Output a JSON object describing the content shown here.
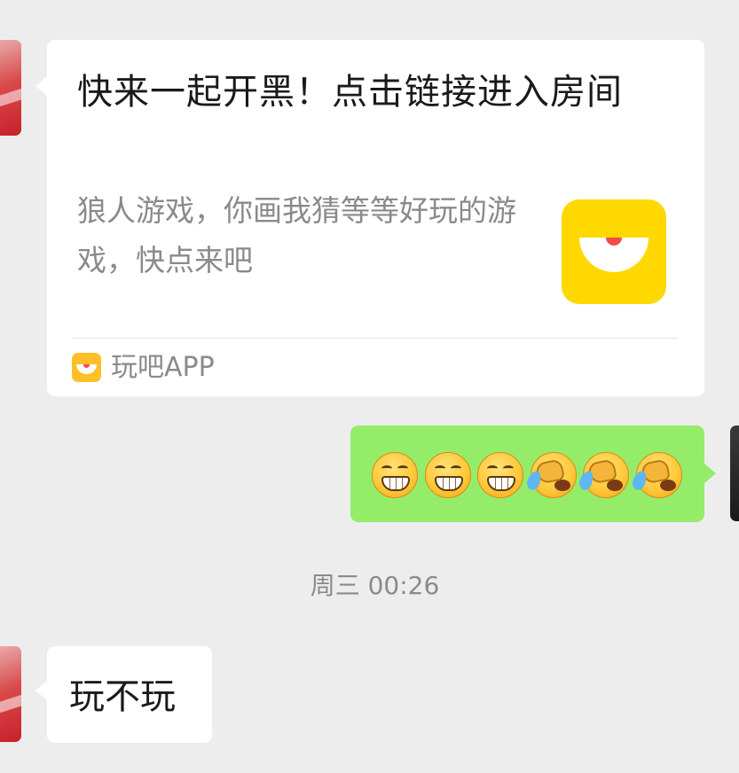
{
  "shared_card": {
    "title": "快来一起开黑！点击链接进入房间",
    "description": "狼人游戏，你画我猜等等好玩的游戏，快点来吧",
    "thumbnail_icon": "yellow-eye-logo",
    "source_app_icon": "yellow-eye-logo",
    "source_app_name": "玩吧APP"
  },
  "reply_bubble": {
    "emojis": [
      "grin",
      "grin",
      "grin",
      "face-palm-laugh",
      "face-palm-laugh",
      "face-palm-laugh"
    ]
  },
  "timestamp": "周三 00:26",
  "last_message": {
    "text": "玩不玩"
  },
  "colors": {
    "background": "#ededed",
    "incoming_bubble": "#ffffff",
    "outgoing_bubble": "#95ec69",
    "brand_yellow": "#ffd800"
  }
}
